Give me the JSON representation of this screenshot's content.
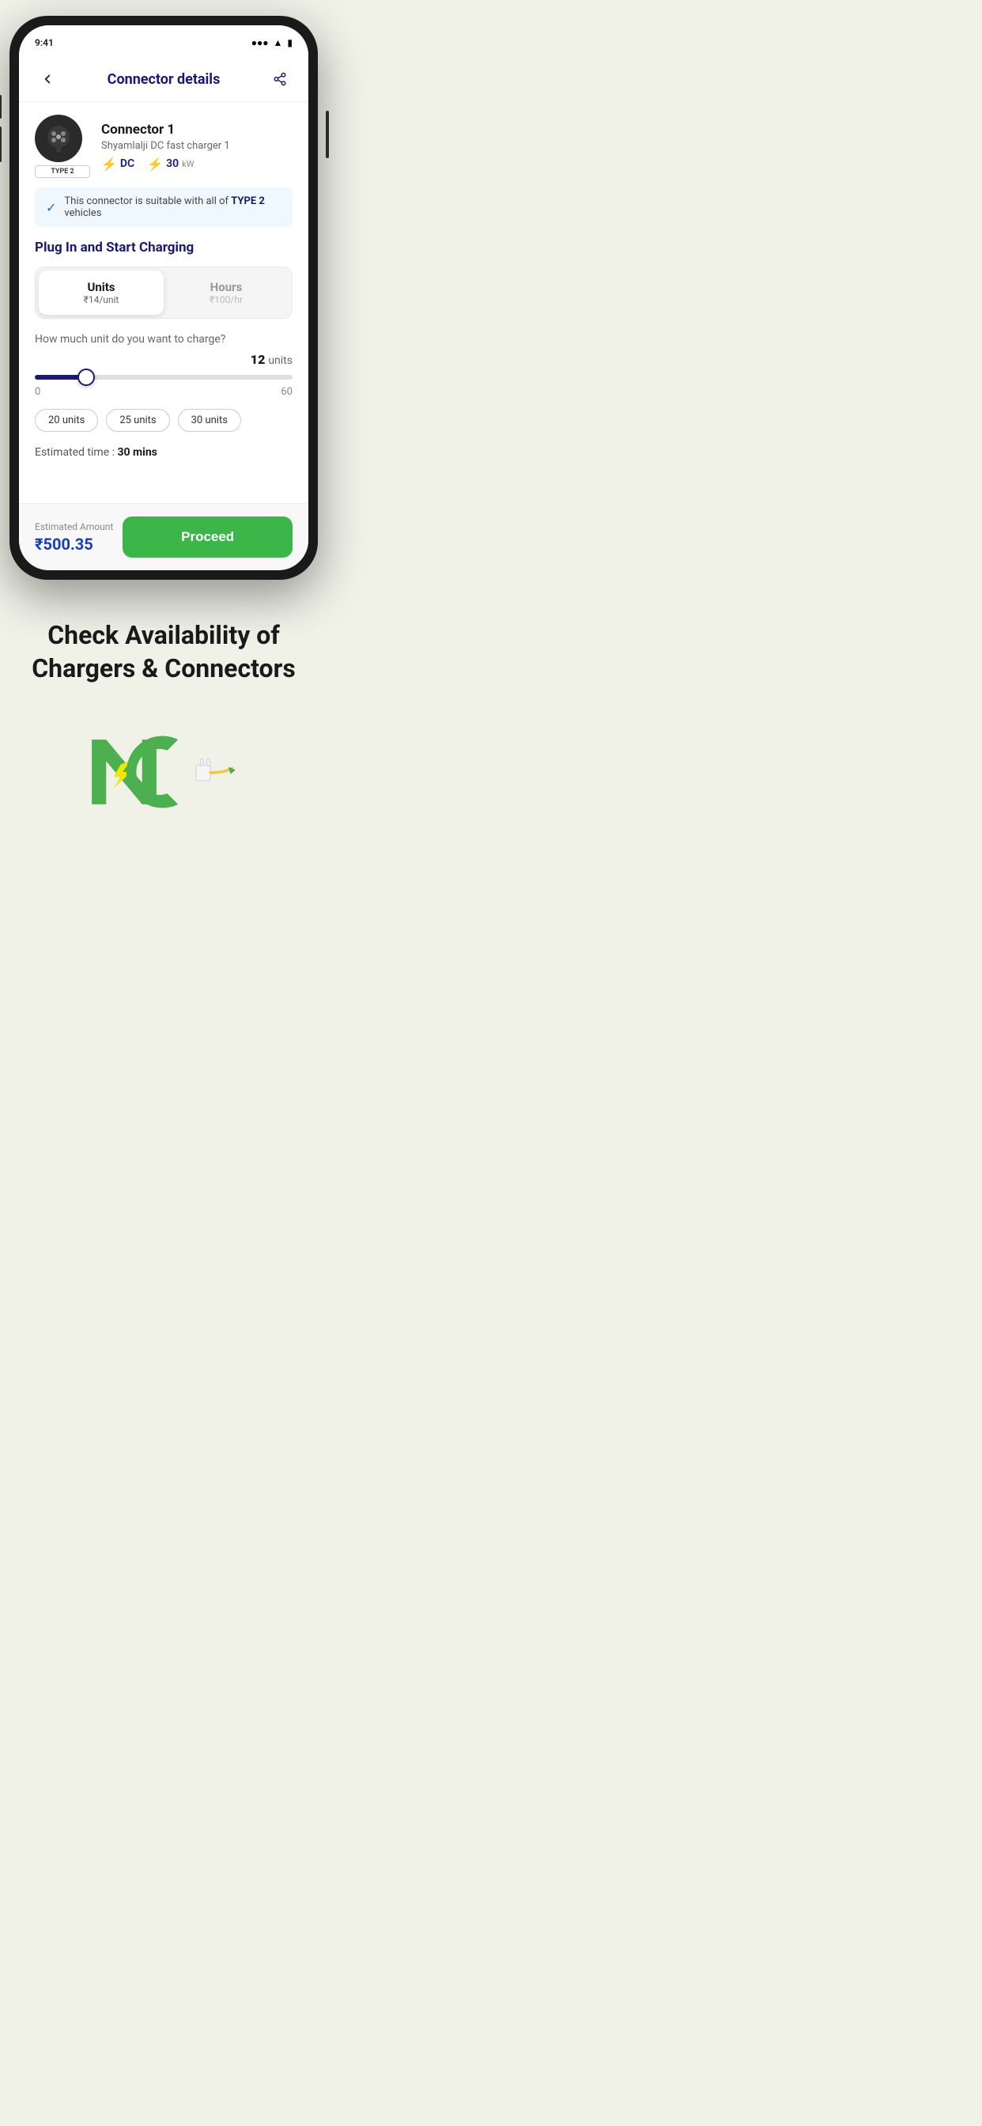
{
  "header": {
    "title": "Connector details",
    "back_label": "←",
    "share_label": "⋮"
  },
  "connector": {
    "name": "Connector 1",
    "station": "Shyamlalji DC fast charger 1",
    "type": "TYPE 2",
    "current_type": "DC",
    "power": "30",
    "power_unit": "kW"
  },
  "compatibility": {
    "text": "This connector is suitable with all of ",
    "highlight": "TYPE 2",
    "suffix": " vehicles"
  },
  "charging_section": {
    "title": "Plug In and Start Charging",
    "tabs": [
      {
        "label": "Units",
        "price": "₹14/unit",
        "active": true
      },
      {
        "label": "Hours",
        "price": "₹100/hr",
        "active": false
      }
    ]
  },
  "units_input": {
    "question": "How much unit do you want to charge?",
    "value": "12",
    "unit_label": "units",
    "min": "0",
    "max": "60",
    "slider_pct": 20
  },
  "quick_chips": [
    {
      "label": "20 units"
    },
    {
      "label": "25 units"
    },
    {
      "label": "30 units"
    }
  ],
  "estimated": {
    "label": "Estimated time : ",
    "value": "30 mins"
  },
  "bottom_bar": {
    "amount_label": "Estimated Amount",
    "amount_value": "₹500.35",
    "proceed_label": "Proceed"
  },
  "promo": {
    "title": "Check Availability of Chargers & Connectors"
  },
  "logo": {
    "text": "NC"
  }
}
